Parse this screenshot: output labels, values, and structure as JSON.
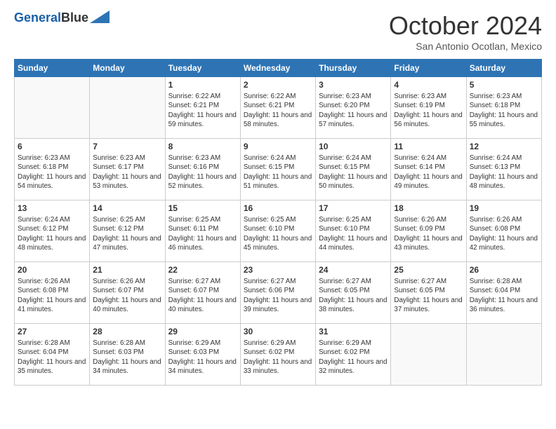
{
  "header": {
    "logo_line1": "General",
    "logo_line2": "Blue",
    "month": "October 2024",
    "location": "San Antonio Ocotlan, Mexico"
  },
  "days_of_week": [
    "Sunday",
    "Monday",
    "Tuesday",
    "Wednesday",
    "Thursday",
    "Friday",
    "Saturday"
  ],
  "weeks": [
    [
      {
        "num": "",
        "info": ""
      },
      {
        "num": "",
        "info": ""
      },
      {
        "num": "1",
        "info": "Sunrise: 6:22 AM\nSunset: 6:21 PM\nDaylight: 11 hours and 59 minutes."
      },
      {
        "num": "2",
        "info": "Sunrise: 6:22 AM\nSunset: 6:21 PM\nDaylight: 11 hours and 58 minutes."
      },
      {
        "num": "3",
        "info": "Sunrise: 6:23 AM\nSunset: 6:20 PM\nDaylight: 11 hours and 57 minutes."
      },
      {
        "num": "4",
        "info": "Sunrise: 6:23 AM\nSunset: 6:19 PM\nDaylight: 11 hours and 56 minutes."
      },
      {
        "num": "5",
        "info": "Sunrise: 6:23 AM\nSunset: 6:18 PM\nDaylight: 11 hours and 55 minutes."
      }
    ],
    [
      {
        "num": "6",
        "info": "Sunrise: 6:23 AM\nSunset: 6:18 PM\nDaylight: 11 hours and 54 minutes."
      },
      {
        "num": "7",
        "info": "Sunrise: 6:23 AM\nSunset: 6:17 PM\nDaylight: 11 hours and 53 minutes."
      },
      {
        "num": "8",
        "info": "Sunrise: 6:23 AM\nSunset: 6:16 PM\nDaylight: 11 hours and 52 minutes."
      },
      {
        "num": "9",
        "info": "Sunrise: 6:24 AM\nSunset: 6:15 PM\nDaylight: 11 hours and 51 minutes."
      },
      {
        "num": "10",
        "info": "Sunrise: 6:24 AM\nSunset: 6:15 PM\nDaylight: 11 hours and 50 minutes."
      },
      {
        "num": "11",
        "info": "Sunrise: 6:24 AM\nSunset: 6:14 PM\nDaylight: 11 hours and 49 minutes."
      },
      {
        "num": "12",
        "info": "Sunrise: 6:24 AM\nSunset: 6:13 PM\nDaylight: 11 hours and 48 minutes."
      }
    ],
    [
      {
        "num": "13",
        "info": "Sunrise: 6:24 AM\nSunset: 6:12 PM\nDaylight: 11 hours and 48 minutes."
      },
      {
        "num": "14",
        "info": "Sunrise: 6:25 AM\nSunset: 6:12 PM\nDaylight: 11 hours and 47 minutes."
      },
      {
        "num": "15",
        "info": "Sunrise: 6:25 AM\nSunset: 6:11 PM\nDaylight: 11 hours and 46 minutes."
      },
      {
        "num": "16",
        "info": "Sunrise: 6:25 AM\nSunset: 6:10 PM\nDaylight: 11 hours and 45 minutes."
      },
      {
        "num": "17",
        "info": "Sunrise: 6:25 AM\nSunset: 6:10 PM\nDaylight: 11 hours and 44 minutes."
      },
      {
        "num": "18",
        "info": "Sunrise: 6:26 AM\nSunset: 6:09 PM\nDaylight: 11 hours and 43 minutes."
      },
      {
        "num": "19",
        "info": "Sunrise: 6:26 AM\nSunset: 6:08 PM\nDaylight: 11 hours and 42 minutes."
      }
    ],
    [
      {
        "num": "20",
        "info": "Sunrise: 6:26 AM\nSunset: 6:08 PM\nDaylight: 11 hours and 41 minutes."
      },
      {
        "num": "21",
        "info": "Sunrise: 6:26 AM\nSunset: 6:07 PM\nDaylight: 11 hours and 40 minutes."
      },
      {
        "num": "22",
        "info": "Sunrise: 6:27 AM\nSunset: 6:07 PM\nDaylight: 11 hours and 40 minutes."
      },
      {
        "num": "23",
        "info": "Sunrise: 6:27 AM\nSunset: 6:06 PM\nDaylight: 11 hours and 39 minutes."
      },
      {
        "num": "24",
        "info": "Sunrise: 6:27 AM\nSunset: 6:05 PM\nDaylight: 11 hours and 38 minutes."
      },
      {
        "num": "25",
        "info": "Sunrise: 6:27 AM\nSunset: 6:05 PM\nDaylight: 11 hours and 37 minutes."
      },
      {
        "num": "26",
        "info": "Sunrise: 6:28 AM\nSunset: 6:04 PM\nDaylight: 11 hours and 36 minutes."
      }
    ],
    [
      {
        "num": "27",
        "info": "Sunrise: 6:28 AM\nSunset: 6:04 PM\nDaylight: 11 hours and 35 minutes."
      },
      {
        "num": "28",
        "info": "Sunrise: 6:28 AM\nSunset: 6:03 PM\nDaylight: 11 hours and 34 minutes."
      },
      {
        "num": "29",
        "info": "Sunrise: 6:29 AM\nSunset: 6:03 PM\nDaylight: 11 hours and 34 minutes."
      },
      {
        "num": "30",
        "info": "Sunrise: 6:29 AM\nSunset: 6:02 PM\nDaylight: 11 hours and 33 minutes."
      },
      {
        "num": "31",
        "info": "Sunrise: 6:29 AM\nSunset: 6:02 PM\nDaylight: 11 hours and 32 minutes."
      },
      {
        "num": "",
        "info": ""
      },
      {
        "num": "",
        "info": ""
      }
    ]
  ]
}
